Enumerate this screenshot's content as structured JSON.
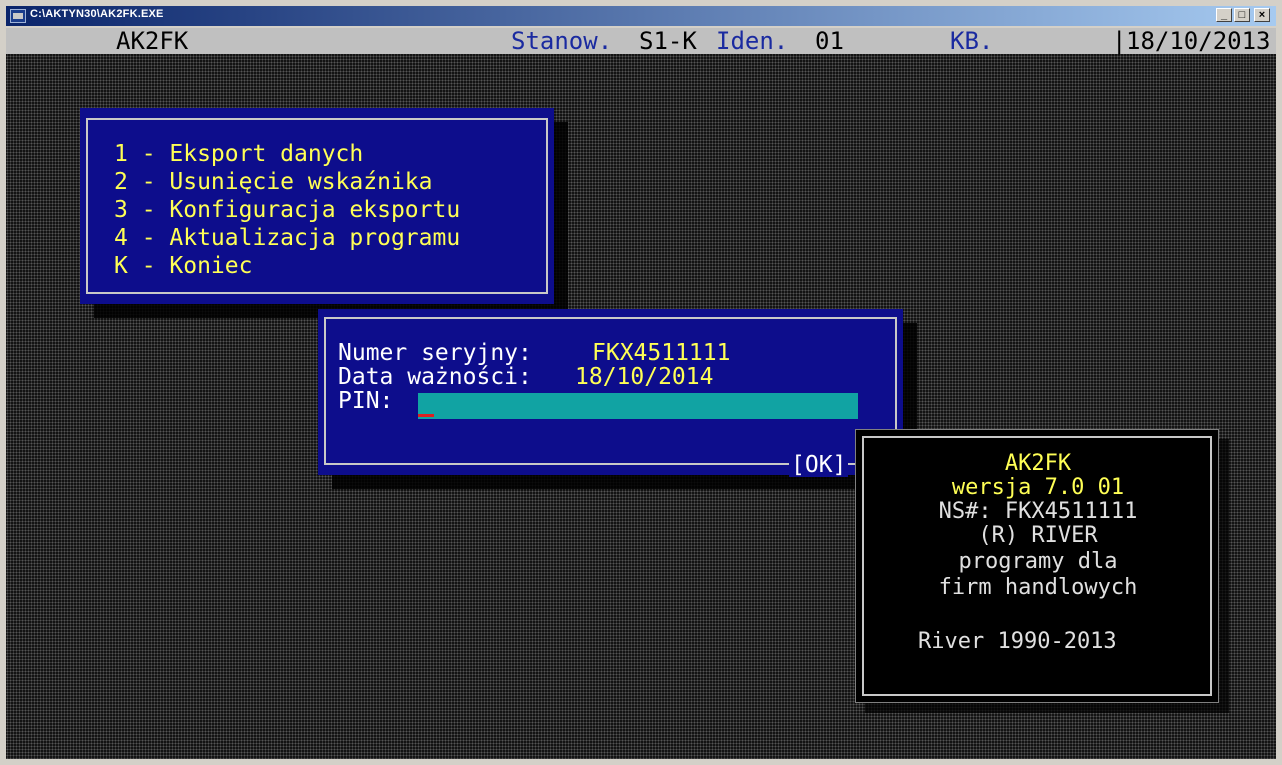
{
  "window": {
    "title": "C:\\AKTYN30\\AK2FK.EXE",
    "buttons": {
      "minimize": "_",
      "maximize": "□",
      "close": "×"
    }
  },
  "statusbar": {
    "app_name": "AK2FK",
    "stanow_label": "Stanow.",
    "stanow_value": "S1-K",
    "iden_label": "Iden.",
    "iden_value": "01",
    "user": "KB.",
    "separator": "|",
    "date": "18/10/2013"
  },
  "menu": {
    "items": [
      "1 - Eksport danych",
      "2 - Usunięcie wskaźnika",
      "3 - Konfiguracja eksportu",
      "4 - Aktualizacja programu",
      "K - Koniec"
    ]
  },
  "serial_dialog": {
    "serial_label": "Numer seryjny:",
    "serial_value": "FKX4511111",
    "date_label": "Data ważności:",
    "date_value": "18/10/2014",
    "pin_label": "PIN:",
    "pin_value": "",
    "ok_label": "[OK]"
  },
  "about": {
    "lines": [
      "AK2FK",
      "wersja 7.0 01",
      "NS#: FKX4511111",
      "(R) RIVER",
      "programy dla",
      "firm handlowych"
    ],
    "copyright": "River 1990-2013"
  },
  "colors": {
    "dialog_bg": "#0d0d8c",
    "menu_text": "#ffff55",
    "pin_field": "#11a3a3",
    "title_gradient_start": "#0a246a"
  }
}
